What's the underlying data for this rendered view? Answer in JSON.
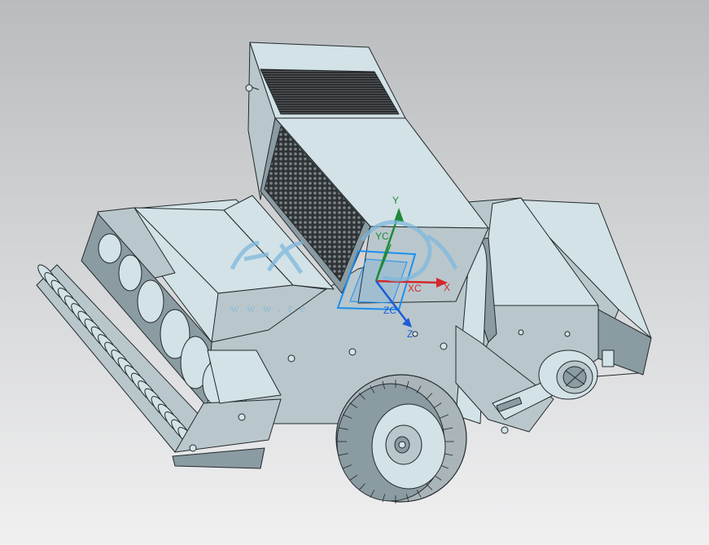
{
  "viewport": {
    "background_top": "#b9bcbe",
    "background_bottom": "#f0f0f1"
  },
  "model": {
    "body_color": "#b9c7cc",
    "body_light": "#d2e2e6",
    "body_dark": "#8a9ba1",
    "edge_color": "#23292c",
    "mesh_color": "#3a3d40",
    "tire_color": "#a9b5b9"
  },
  "triad": {
    "y_label": "Y",
    "x_label": "X",
    "z_label": "Z",
    "yc_label": "YC",
    "xc_label": "XC",
    "zc_label": "ZC",
    "y_color": "#1e8a3a",
    "x_color": "#d3282c",
    "z_color": "#1f5bd6",
    "plane_color": "#1a8ff0"
  },
  "watermark": {
    "url_text": "www.re",
    "color": "#7fb8dd"
  }
}
